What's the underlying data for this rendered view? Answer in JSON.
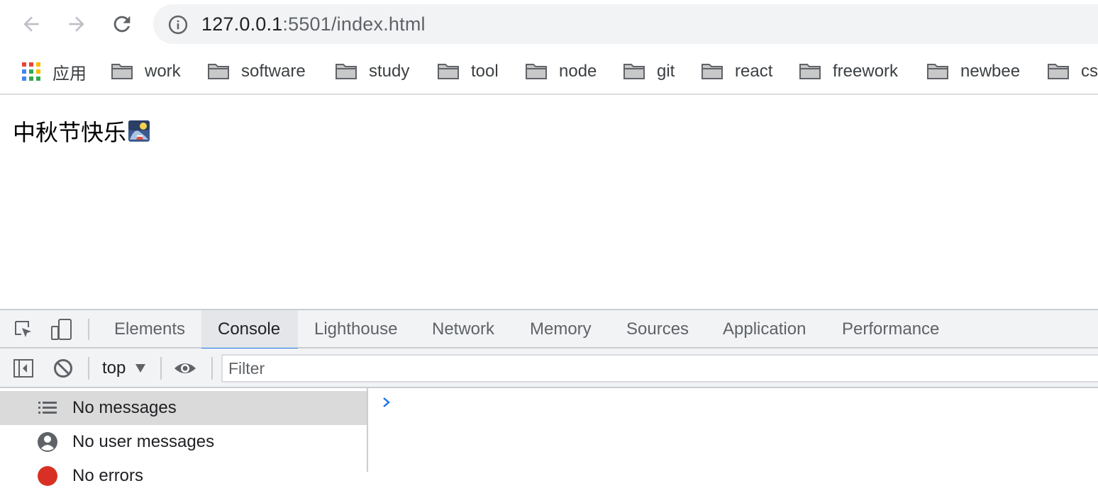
{
  "browser": {
    "url_host": "127.0.0.1",
    "url_rest": ":5501/index.html",
    "bookmarks": [
      {
        "label": "应用",
        "icon": "apps-grid-icon"
      },
      {
        "label": "work",
        "icon": "folder-icon"
      },
      {
        "label": "software",
        "icon": "folder-icon"
      },
      {
        "label": "study",
        "icon": "folder-icon"
      },
      {
        "label": "tool",
        "icon": "folder-icon"
      },
      {
        "label": "node",
        "icon": "folder-icon"
      },
      {
        "label": "git",
        "icon": "folder-icon"
      },
      {
        "label": "react",
        "icon": "folder-icon"
      },
      {
        "label": "freework",
        "icon": "folder-icon"
      },
      {
        "label": "newbee",
        "icon": "folder-icon"
      },
      {
        "label": "cs",
        "icon": "folder-icon"
      }
    ]
  },
  "page": {
    "greeting": "中秋节快乐"
  },
  "devtools": {
    "tabs": [
      {
        "label": "Elements"
      },
      {
        "label": "Console"
      },
      {
        "label": "Lighthouse"
      },
      {
        "label": "Network"
      },
      {
        "label": "Memory"
      },
      {
        "label": "Sources"
      },
      {
        "label": "Application"
      },
      {
        "label": "Performance"
      }
    ],
    "active_tab": "Console",
    "context": "top",
    "filter_placeholder": "Filter",
    "sidebar": [
      {
        "label": "No messages",
        "icon": "list-icon",
        "selected": true
      },
      {
        "label": "No user messages",
        "icon": "user-circle-icon",
        "selected": false
      },
      {
        "label": "No errors",
        "icon": "error-circle-icon",
        "selected": false
      }
    ]
  },
  "colors": {
    "accent": "#1a73e8",
    "toolbar_bg": "#f1f3f4",
    "error": "#d93025"
  }
}
